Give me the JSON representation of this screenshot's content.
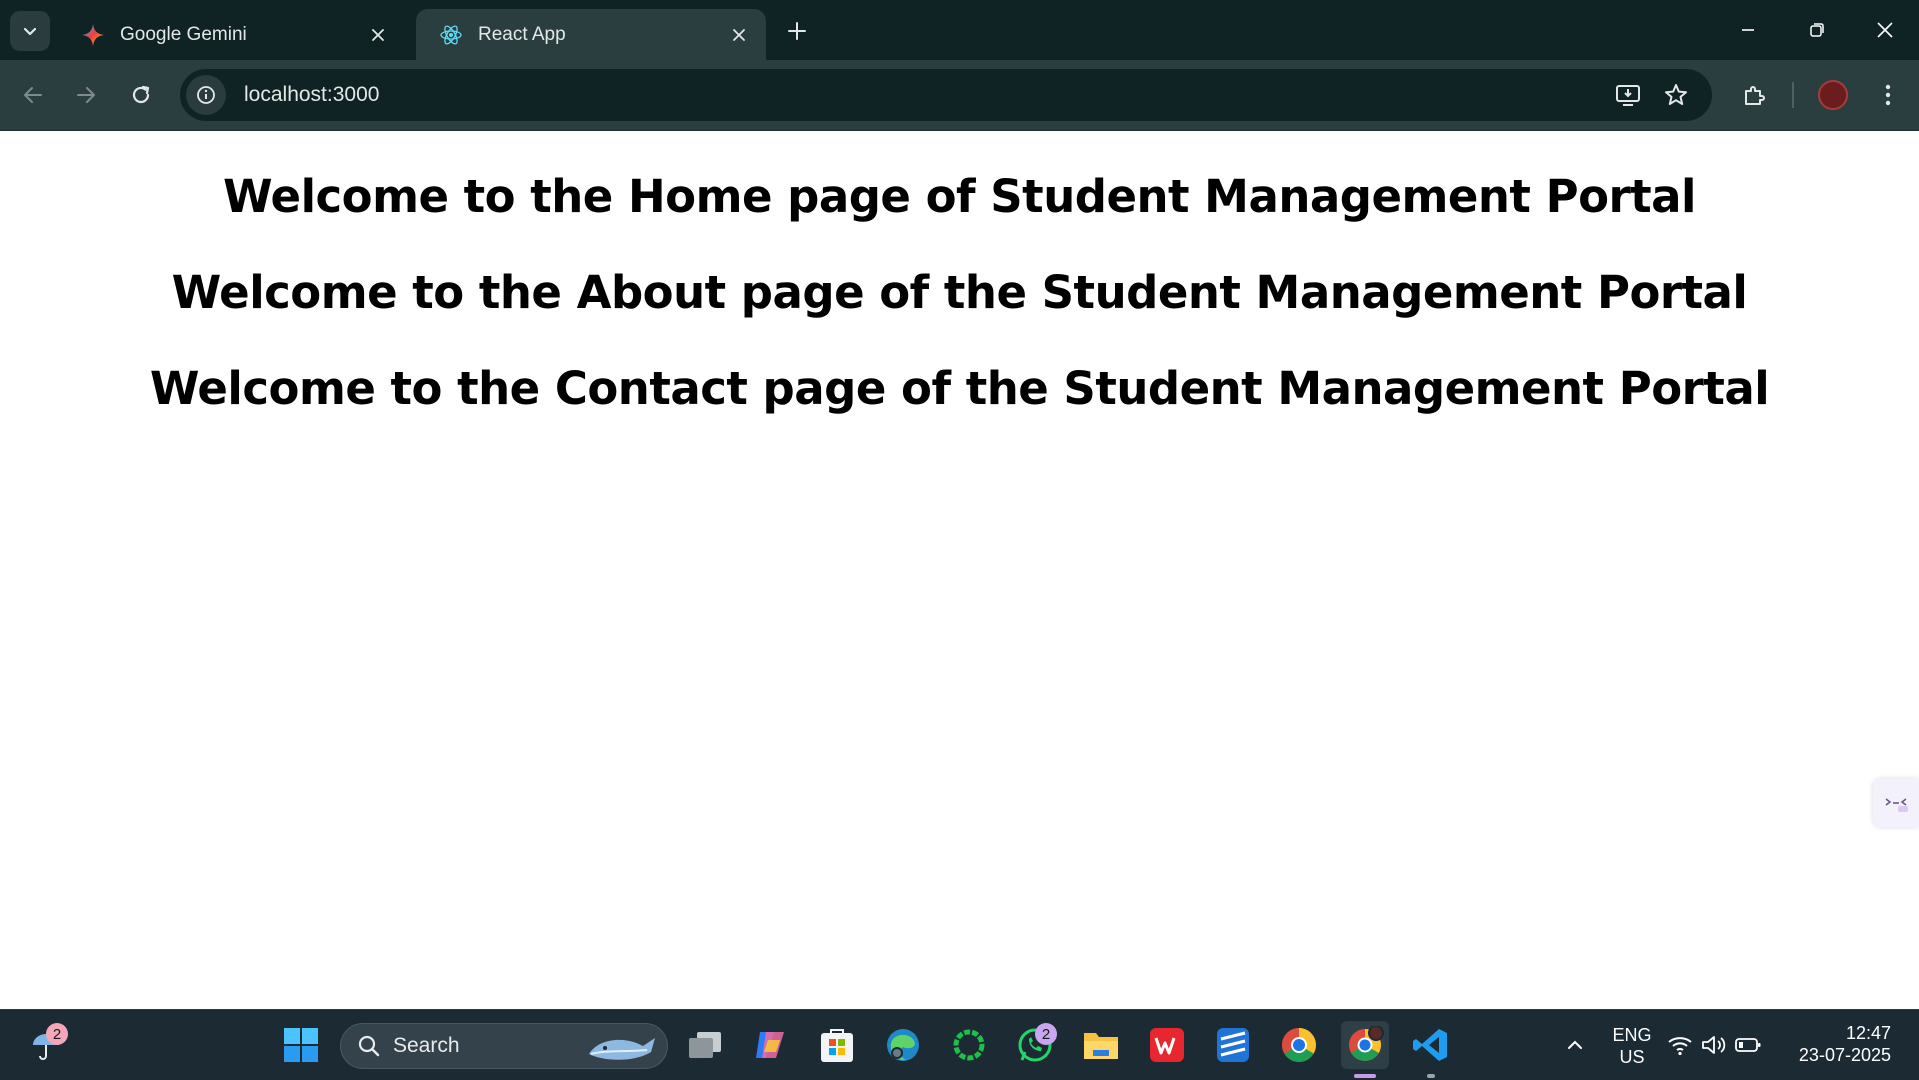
{
  "browser": {
    "tabs": [
      {
        "title": "Google Gemini",
        "icon": "gemini-icon",
        "active": false
      },
      {
        "title": "React App",
        "icon": "react-icon",
        "active": true
      }
    ],
    "address": "localhost:3000"
  },
  "page": {
    "headings": [
      "Welcome to the Home page of Student Management Portal",
      "Welcome to the About page of the Student Management Portal",
      "Welcome to the Contact page of the Student Management Portal"
    ]
  },
  "taskbar": {
    "weather_badge": "2",
    "search_label": "Search",
    "whatsapp_badge": "2",
    "language_line1": "ENG",
    "language_line2": "US",
    "time": "12:47",
    "date": "23-07-2025",
    "apps": [
      "start-icon",
      "search",
      "task-view-icon",
      "copilot-icon",
      "microsoft-store-icon",
      "edge-icon",
      "app-ring-icon",
      "whatsapp-icon",
      "file-explorer-icon",
      "wps-office-icon",
      "app-blue-icon",
      "chrome-icon",
      "chrome-profile-icon",
      "vscode-icon"
    ]
  },
  "colors": {
    "tabstrip": "#0f2324",
    "toolbar": "#2b3e3f",
    "taskbar": "#1b2a33"
  }
}
